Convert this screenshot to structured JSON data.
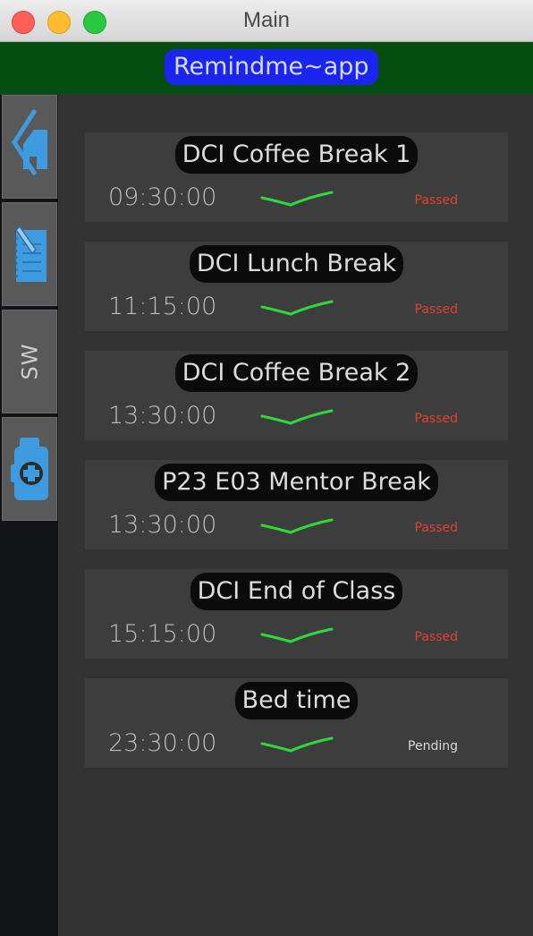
{
  "window": {
    "title": "Main"
  },
  "header": {
    "app_name": "Remindme~app"
  },
  "sidebar": {
    "items": [
      {
        "icon": "home-icon"
      },
      {
        "icon": "notebook-edit-icon"
      },
      {
        "label": "SW"
      },
      {
        "icon": "first-aid-kit-icon"
      }
    ]
  },
  "colors": {
    "passed": "#e0412f",
    "pending": "#d9d9d9",
    "check": "#2fd93a",
    "accent_icon": "#3e9be0"
  },
  "reminders": [
    {
      "title": "DCI Coffee Break 1",
      "time": "09:30:00",
      "status": "Passed"
    },
    {
      "title": "DCI Lunch Break",
      "time": "11:15:00",
      "status": "Passed"
    },
    {
      "title": "DCI Coffee Break 2",
      "time": "13:30:00",
      "status": "Passed"
    },
    {
      "title": "P23 E03 Mentor Break",
      "time": "13:30:00",
      "status": "Passed"
    },
    {
      "title": "DCI End of Class",
      "time": "15:15:00",
      "status": "Passed"
    },
    {
      "title": "Bed time",
      "time": "23:30:00",
      "status": "Pending"
    }
  ]
}
